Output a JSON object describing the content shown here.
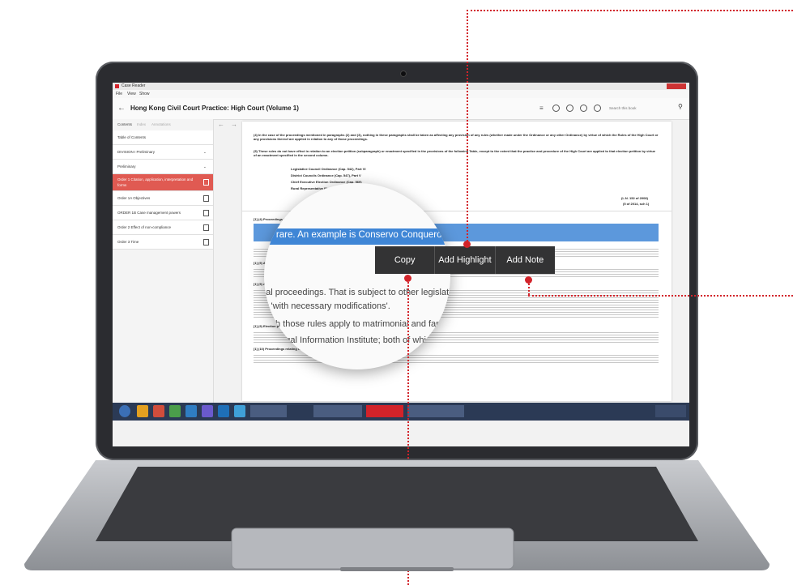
{
  "app": {
    "window_title": "Case Reader",
    "menu": [
      "File",
      "View",
      "Show"
    ],
    "title": "Hong Kong Civil Court Practice: High Court (Volume 1)",
    "search_placeholder": "Search this book"
  },
  "sidebar": {
    "tabs": [
      "Contents",
      "Index",
      "Annotations"
    ],
    "items": [
      {
        "label": "Table of Contents",
        "active": false
      },
      {
        "label": "DIVISION I Preliminary",
        "active": false
      },
      {
        "label": "Preliminary",
        "active": false
      },
      {
        "label": "Order 1 Citation, application, interpretation and forms",
        "active": true
      },
      {
        "label": "Order 1A Objectives",
        "active": false
      },
      {
        "label": "ORDER 1B Case management powers",
        "active": false
      },
      {
        "label": "Order 2 Effect of non-compliance",
        "active": false
      },
      {
        "label": "Order 3 Time",
        "active": false
      }
    ]
  },
  "document": {
    "lines": [
      "(4) In the case of the proceedings mentioned in paragraphs (2) and (3), nothing in these paragraphs shall be taken as affecting any provision of any rules (whether made under the Ordinance or any other Ordinance)",
      "by virtue of which the Rules of the High Court or any provisions thereof are applied in relation to any of those proceedings.",
      "(5) These rules do not have effect in relation to an election petition (subparagraph) or enactment specified in the provisions of the following Table, except to the extent that the practice and procedure of the High",
      "Court are applied to that election petition by virtue of an enactment specified in the second column.",
      "Legislative Council Ordinance (Cap. 542), Part VI",
      "District Councils Ordinance (Cap. 547), Part V",
      "Chief Executive Election Ordinance (Cap. 569)",
      "Rural Representative Election Ordinance (Cap. 576)",
      "(L.N. 152 of 2008)",
      "(5 of 2014, sch 1)",
      "[1] (4) Proceedings to grow",
      "[1] (5) Application to matrimonial and family proceedings",
      "[1] (5) Application to criminal proceedings",
      "[1] (9) Election petitions",
      "[1] (10) Proceedings relating to companies"
    ],
    "magnified_highlight": "very rare. An example is Conservo Conquero Limitada v AIG of Gib",
    "magnified_line_1": "nal proceedings. That is subject to other legislative provisions",
    "magnified_line_2": "y 'with necessary modifications'.",
    "magnified_line_3": "hich those rules apply to matrimonial and family proc",
    "magnified_line_4": "Legal Information Institute; both of which are acc"
  },
  "popup": {
    "copy": "Copy",
    "add_highlight": "Add Highlight",
    "add_note": "Add Note"
  },
  "colors": {
    "accent": "#d2232a",
    "active_item": "#e05a52",
    "popup_bg": "#333334",
    "highlight": "#3f86d6"
  }
}
